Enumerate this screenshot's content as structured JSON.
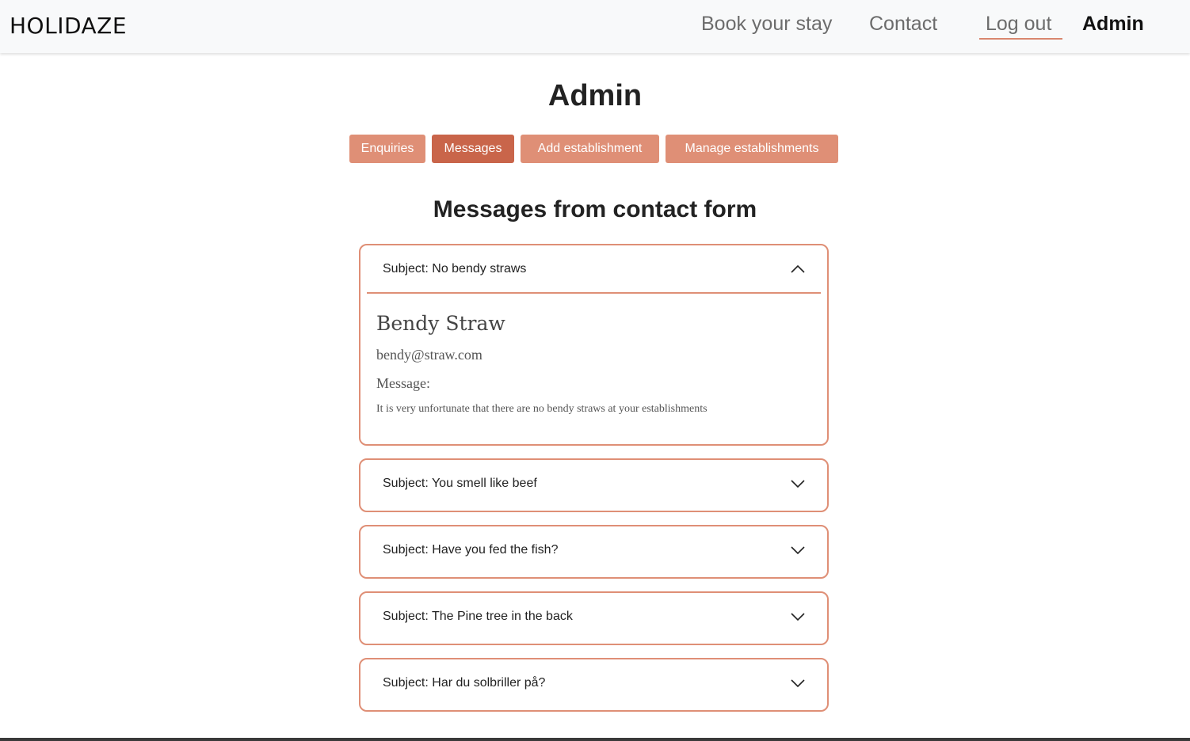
{
  "brand": "HOLIDAZE",
  "nav": {
    "book": "Book your stay",
    "contact": "Contact",
    "logout": "Log out",
    "admin": "Admin"
  },
  "page_title": "Admin",
  "tabs": [
    {
      "label": "Enquiries",
      "active": false
    },
    {
      "label": "Messages",
      "active": true
    },
    {
      "label": "Add establishment",
      "active": false
    },
    {
      "label": "Manage establishments",
      "active": false
    }
  ],
  "section_title": "Messages from contact form",
  "messages": [
    {
      "subject": "Subject: No bendy straws",
      "expanded": true,
      "name": "Bendy Straw",
      "email": "bendy@straw.com",
      "message_label": "Message:",
      "message": "It is very unfortunate that there are no bendy straws at your establishments"
    },
    {
      "subject": "Subject: You smell like beef",
      "expanded": false
    },
    {
      "subject": "Subject: Have you fed the fish?",
      "expanded": false
    },
    {
      "subject": "Subject: The Pine tree in the back",
      "expanded": false
    },
    {
      "subject": "Subject: Har du solbriller på?",
      "expanded": false
    }
  ],
  "colors": {
    "accent": "#df8f76",
    "accent_active": "#c9654a"
  },
  "icons": {
    "expanded": "chevron-up-icon",
    "collapsed": "chevron-down-icon"
  }
}
